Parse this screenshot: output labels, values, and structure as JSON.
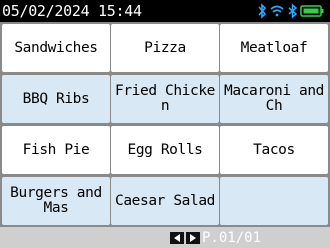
{
  "status_bar": {
    "datetime": "05/02/2024 15:44",
    "icons": [
      "bluetooth-icon",
      "wifi-icon",
      "bluetooth-icon",
      "battery-icon"
    ],
    "accent_color": "#2ca7ff",
    "battery_color": "#34d04a"
  },
  "menu": {
    "items": [
      {
        "label": "Sandwiches"
      },
      {
        "label": "Pizza"
      },
      {
        "label": "Meatloaf"
      },
      {
        "label": "BBQ Ribs"
      },
      {
        "label": "Fried Chicke\nn"
      },
      {
        "label": "Macaroni and\nCh"
      },
      {
        "label": "Fish Pie"
      },
      {
        "label": "Egg Rolls"
      },
      {
        "label": "Tacos"
      },
      {
        "label": "Burgers and\nMas"
      },
      {
        "label": "Caesar Salad"
      },
      {
        "label": ""
      }
    ]
  },
  "footer": {
    "prev_icon": "chevron-left-icon",
    "next_icon": "chevron-right-icon",
    "page_indicator": "P.01/01"
  }
}
